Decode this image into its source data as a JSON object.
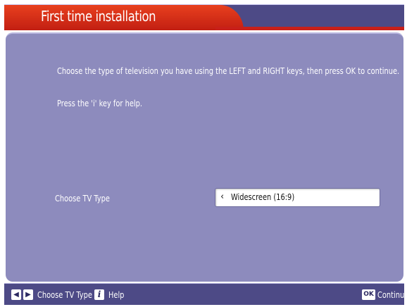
{
  "header": {
    "title": "First time installation"
  },
  "main": {
    "instruction": "Choose the type of television you have using the LEFT and RIGHT keys, then press OK to continue.",
    "help": "Press the 'i' key for help.",
    "tv_type_label": "Choose TV Type",
    "tv_type_value": "Widescreen (16:9)",
    "tv_type_arrow": "‹"
  },
  "footer": {
    "left_key_glyph": "◀",
    "right_key_glyph": "▶",
    "choose_label": "Choose TV Type",
    "info_key_glyph": "i",
    "help_label": "Help",
    "ok_key_glyph": "OK",
    "continue_label": "Continue"
  },
  "colors": {
    "header_red": "#d42b15",
    "header_purple": "#4d4a86",
    "panel": "#8d8bbd",
    "text": "#ffffff"
  }
}
